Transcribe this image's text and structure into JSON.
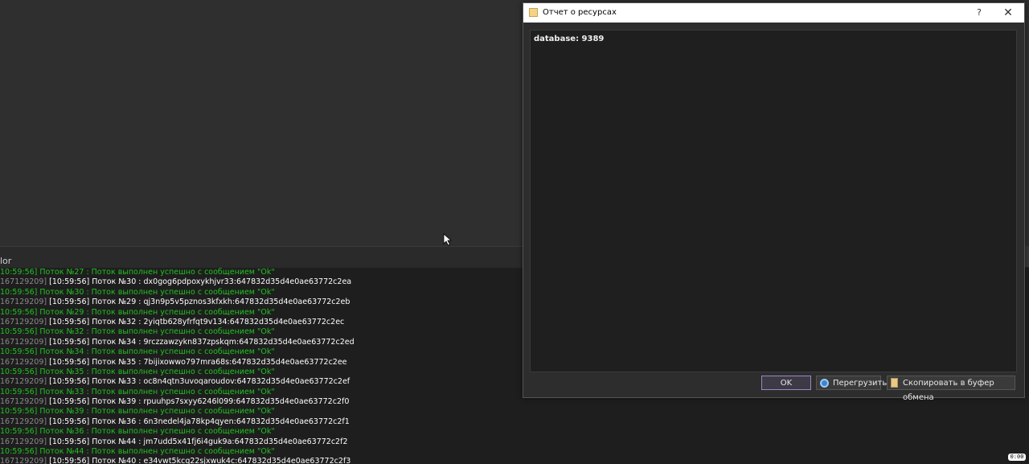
{
  "panel": {
    "label": "lor"
  },
  "log": [
    {
      "type": "ok",
      "text": "10:59:56] Поток №27 : Поток выполнен успешно с сообщением \"Ok\""
    },
    {
      "type": "info",
      "tag": "167129209]",
      "text": " [10:59:56] Поток №30 : dx0gog6pdpoxykhjvr33:647832d35d4e0ae63772c2ea"
    },
    {
      "type": "ok",
      "text": "10:59:56] Поток №30 : Поток выполнен успешно с сообщением \"Ok\""
    },
    {
      "type": "info",
      "tag": "167129209]",
      "text": " [10:59:56] Поток №29 : qj3n9p5v5pznos3kfxkh:647832d35d4e0ae63772c2eb"
    },
    {
      "type": "ok",
      "text": "10:59:56] Поток №29 : Поток выполнен успешно с сообщением \"Ok\""
    },
    {
      "type": "info",
      "tag": "167129209]",
      "text": " [10:59:56] Поток №32 : 2yiqtb628yfrfqt9v134:647832d35d4e0ae63772c2ec"
    },
    {
      "type": "ok",
      "text": "10:59:56] Поток №32 : Поток выполнен успешно с сообщением \"Ok\""
    },
    {
      "type": "info",
      "tag": "167129209]",
      "text": " [10:59:56] Поток №34 : 9rczzawzykn837zpskqm:647832d35d4e0ae63772c2ed"
    },
    {
      "type": "ok",
      "text": "10:59:56] Поток №34 : Поток выполнен успешно с сообщением \"Ok\""
    },
    {
      "type": "info",
      "tag": "167129209]",
      "text": " [10:59:56] Поток №35 : 7bijixowwo797mra68s:647832d35d4e0ae63772c2ee"
    },
    {
      "type": "ok",
      "text": "10:59:56] Поток №35 : Поток выполнен успешно с сообщением \"Ok\""
    },
    {
      "type": "info",
      "tag": "167129209]",
      "text": " [10:59:56] Поток №33 : oc8n4qtn3uvoqaroudov:647832d35d4e0ae63772c2ef"
    },
    {
      "type": "ok",
      "text": "10:59:56] Поток №33 : Поток выполнен успешно с сообщением \"Ok\""
    },
    {
      "type": "info",
      "tag": "167129209]",
      "text": " [10:59:56] Поток №39 : rpuuhps7sxyy6246l099:647832d35d4e0ae63772c2f0"
    },
    {
      "type": "ok",
      "text": "10:59:56] Поток №39 : Поток выполнен успешно с сообщением \"Ok\""
    },
    {
      "type": "info",
      "tag": "167129209]",
      "text": " [10:59:56] Поток №36 : 6n3nedel4ja78kp4qyen:647832d35d4e0ae63772c2f1"
    },
    {
      "type": "ok",
      "text": "10:59:56] Поток №36 : Поток выполнен успешно с сообщением \"Ok\""
    },
    {
      "type": "info",
      "tag": "167129209]",
      "text": " [10:59:56] Поток №44 : jm7udd5x41fj6i4guk9a:647832d35d4e0ae63772c2f2"
    },
    {
      "type": "ok",
      "text": "10:59:56] Поток №44 : Поток выполнен успешно с сообщением \"Ok\""
    },
    {
      "type": "info",
      "tag": "167129209]",
      "text": " [10:59:56] Поток №40 : e34vwt5kcq22sjxwuk4c:647832d35d4e0ae63772c2f3"
    }
  ],
  "dialog": {
    "title": "Отчет о ресурсах",
    "help": "?",
    "close": "✕",
    "report_text": "database: 9389",
    "buttons": {
      "ok": "OK",
      "reload": "Перегрузить",
      "copy": "Скопировать в буфер обмена"
    }
  },
  "tray": {
    "text": "0:00"
  },
  "colors": {
    "ok_text": "#21c021",
    "info_text": "#ffffff",
    "tag_text": "#8a8a8a"
  }
}
